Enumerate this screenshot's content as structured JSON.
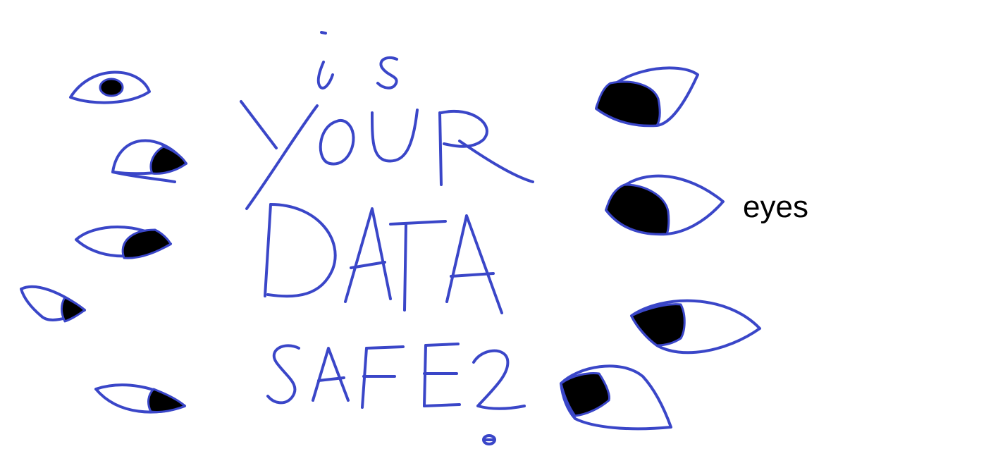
{
  "sketch": {
    "handwritten_words": [
      "is",
      "YOUR",
      "DATA",
      "SAFE?"
    ],
    "typed_label": "eyes",
    "ink_color": "#3a46c8",
    "pupil_color": "#000000",
    "background_color": "#ffffff",
    "eye_count": 9
  }
}
